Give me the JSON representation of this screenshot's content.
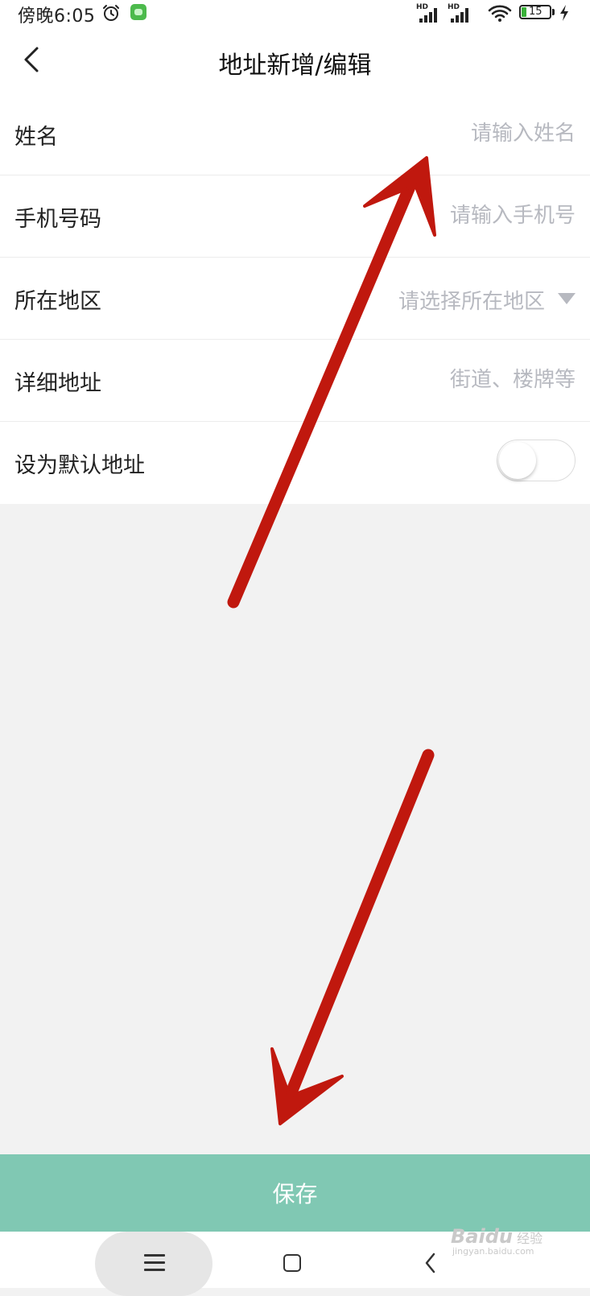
{
  "status_bar": {
    "time": "傍晚6:05",
    "signal_label": "HD",
    "battery": "15"
  },
  "header": {
    "title": "地址新增/编辑"
  },
  "form": {
    "name": {
      "label": "姓名",
      "placeholder": "请输入姓名"
    },
    "phone": {
      "label": "手机号码",
      "placeholder": "请输入手机号"
    },
    "region": {
      "label": "所在地区",
      "placeholder": "请选择所在地区"
    },
    "address": {
      "label": "详细地址",
      "placeholder": "街道、楼牌等"
    },
    "default": {
      "label": "设为默认地址",
      "enabled": false
    }
  },
  "save_button": {
    "label": "保存"
  },
  "watermark": {
    "brand": "Bai",
    "brand2": "du",
    "suffix": "经验",
    "url": "jingyan.baidu.com"
  },
  "colors": {
    "accent": "#80c8b3",
    "placeholder": "#b7b9c0",
    "background": "#f2f2f2",
    "annotation_arrow": "#c0180e"
  },
  "icons": [
    "back-arrow-icon",
    "alarm-icon",
    "app-icon",
    "signal-icon",
    "wifi-icon",
    "battery-icon",
    "bolt-icon",
    "dropdown-arrow-icon",
    "menu-icon",
    "home-icon",
    "nav-back-icon"
  ]
}
